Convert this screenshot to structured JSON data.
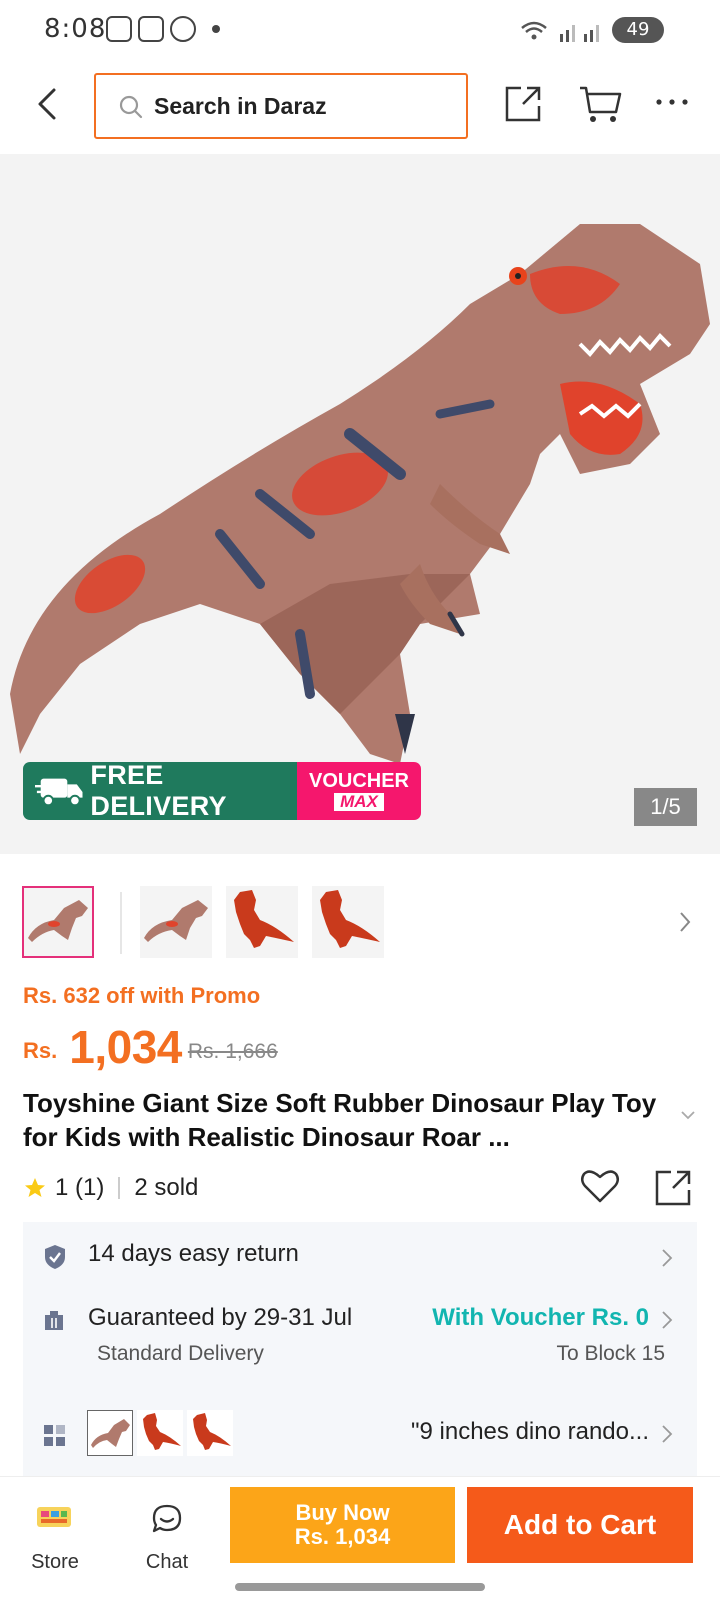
{
  "status_bar": {
    "time": "8:08",
    "battery": "49"
  },
  "header": {
    "search_placeholder": "Search in Daraz"
  },
  "gallery": {
    "promo_free": "FREE DELIVERY",
    "promo_voucher_1": "VOUCHER",
    "promo_voucher_2": "MAX",
    "counter": "1/5"
  },
  "product": {
    "promo_text": "Rs. 632 off with Promo",
    "currency": "Rs.",
    "price": "1,034",
    "old_price": "Rs. 1,666",
    "title": "Toyshine Giant Size Soft Rubber Dinosaur Play Toy for Kids with Realistic Dinosaur Roar ...",
    "rating": "1 (1)",
    "sold": "2 sold"
  },
  "info": {
    "return": "14 days easy return",
    "delivery": "Guaranteed by 29-31 Jul",
    "voucher": "With Voucher Rs. 0",
    "delivery_type": "Standard Delivery",
    "destination": "To Block 15",
    "variant": "\"9 inches dino rando..."
  },
  "bottom": {
    "store": "Store",
    "chat": "Chat",
    "buy_now_1": "Buy Now",
    "buy_now_2": "Rs. 1,034",
    "add_to_cart": "Add to Cart"
  },
  "colors": {
    "accent": "#f36f21",
    "buy_now": "#fca518",
    "add_to_cart": "#f55a1a",
    "voucher_teal": "#12b5b0",
    "free_delivery_green": "#1f7a5d",
    "voucher_pink": "#f5176d"
  }
}
